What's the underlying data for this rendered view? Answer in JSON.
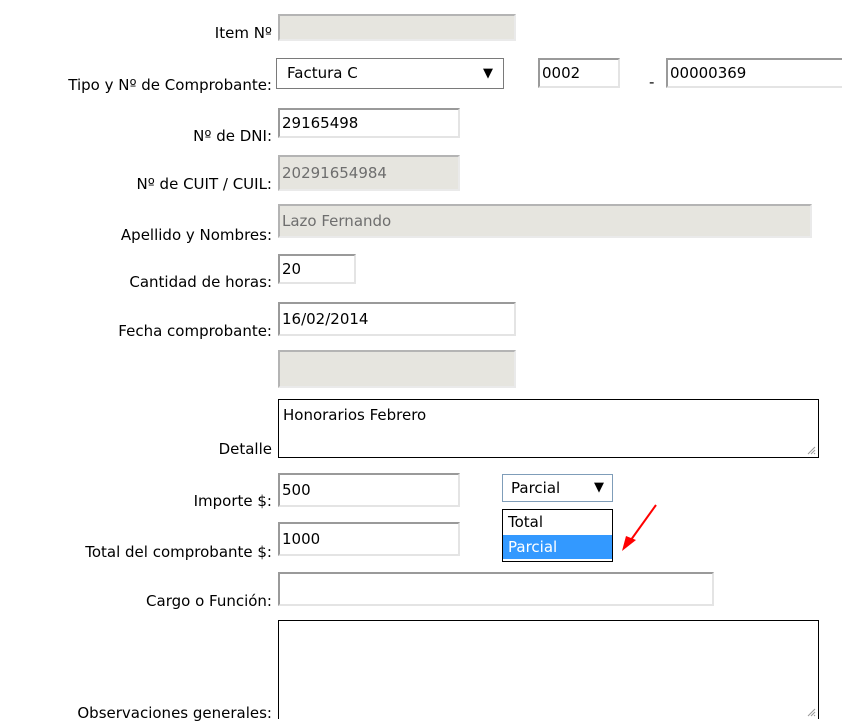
{
  "form": {
    "item": {
      "label": "Item Nº",
      "value": ""
    },
    "comprobante": {
      "label": "Tipo y Nº de Comprobante:",
      "tipo": "Factura C",
      "punto_venta": "0002",
      "separator": "-",
      "numero": "00000369"
    },
    "dni": {
      "label": "Nº de DNI:",
      "value": "29165498"
    },
    "cuit": {
      "label": "Nº de CUIT / CUIL:",
      "value": "20291654984"
    },
    "apellido": {
      "label": "Apellido y Nombres:",
      "value": "Lazo Fernando"
    },
    "horas": {
      "label": "Cantidad de horas:",
      "value": "20"
    },
    "fecha": {
      "label": "Fecha comprobante:",
      "value": "16/02/2014"
    },
    "extra": {
      "value": ""
    },
    "detalle": {
      "label": "Detalle",
      "value": "Honorarios Febrero"
    },
    "importe": {
      "label": "Importe $:",
      "value": "500",
      "tipo_pago": {
        "selected": "Parcial",
        "options": [
          "Total",
          "Parcial"
        ],
        "highlighted": "Parcial"
      }
    },
    "total": {
      "label": "Total del comprobante $:",
      "value": "1000"
    },
    "cargo": {
      "label": "Cargo o Función:",
      "value": ""
    },
    "observaciones": {
      "label": "Observaciones generales:",
      "value": ""
    }
  },
  "icons": {
    "dropdown_arrow": "▼",
    "annotation": "red-arrow-icon",
    "resize": "resize-grip-icon"
  },
  "colors": {
    "highlight": "#3399ff",
    "annotation_arrow": "#ff0000",
    "disabled_bg": "#e6e5df"
  }
}
